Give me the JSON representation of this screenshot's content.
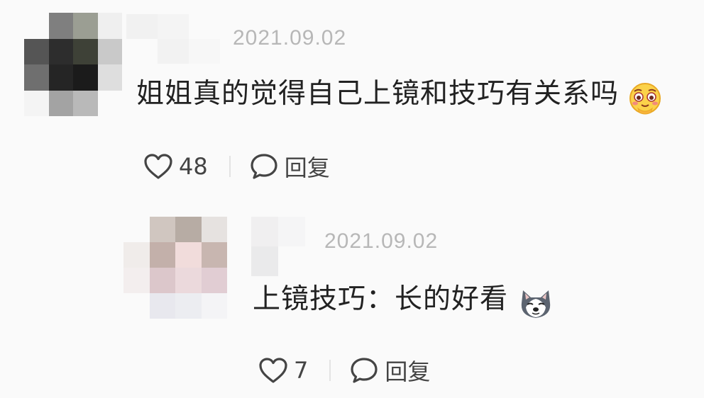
{
  "colors": {
    "background": "#fafafa",
    "text": "#222222",
    "timestamp": "#b7b7b7",
    "action": "#444444"
  },
  "comments": [
    {
      "timestamp": "2021.09.02",
      "text": "姐姐真的觉得自己上镜和技巧有关系吗",
      "emoji": "blush-sweat-emoji",
      "likes": "48",
      "reply_label": "回复"
    },
    {
      "timestamp": "2021.09.02",
      "text": "上镜技巧：长的好看",
      "emoji": "husky-dog-emoji",
      "likes": "7",
      "reply_label": "回复"
    }
  ]
}
